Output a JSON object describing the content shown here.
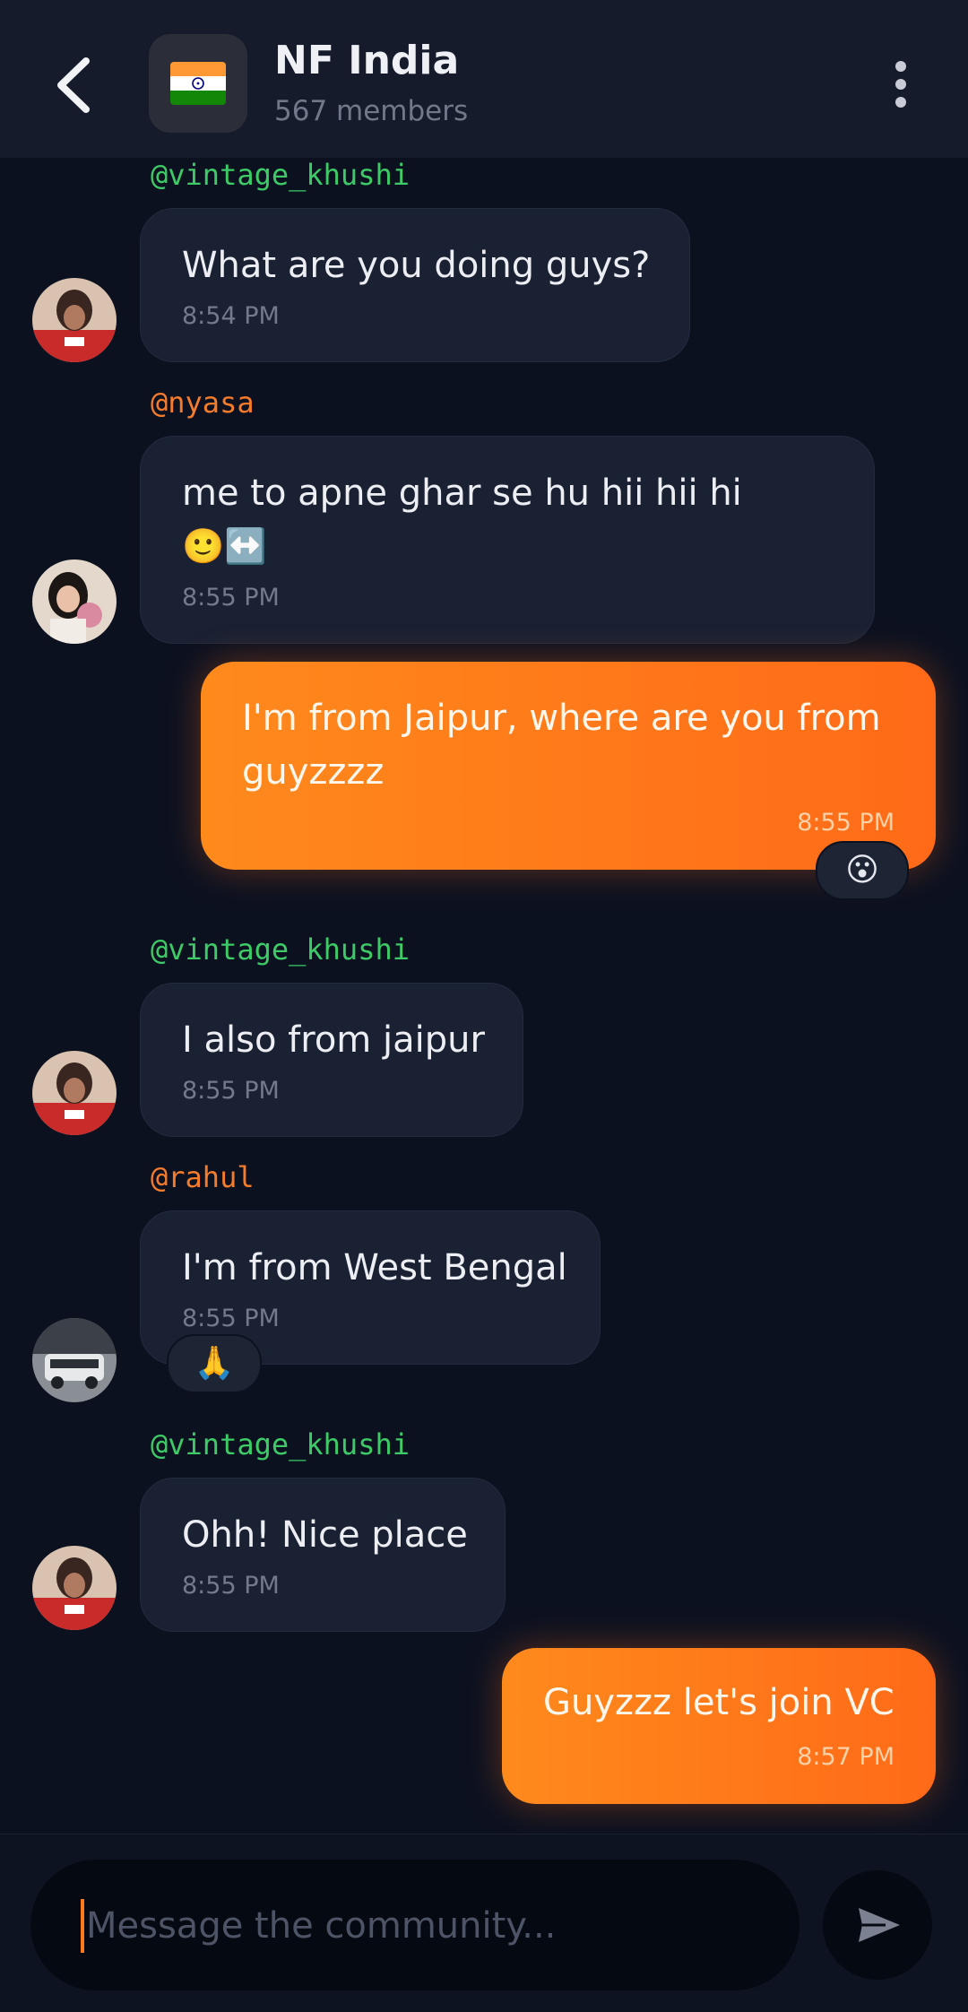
{
  "header": {
    "title": "NF India",
    "subtitle": "567 members",
    "back_icon": "chevron-left-icon",
    "menu_icon": "more-vertical-icon",
    "avatar_icon": "india-flag-icon"
  },
  "messages": [
    {
      "user": "@vintage_khushi",
      "text": "What are you doing guys?",
      "time": "8:54 PM"
    },
    {
      "user": "@nyasa",
      "text": "me to apne ghar se hu hii hii hi",
      "emoji": "🙂↔️",
      "time": "8:55 PM"
    },
    {
      "own": true,
      "line1": "I'm from Jaipur, where are you from",
      "line2": "guyzzzz",
      "time": "8:55 PM",
      "reaction": "😮"
    },
    {
      "user": "@vintage_khushi",
      "text": "I also from jaipur",
      "time": "8:55 PM"
    },
    {
      "user": "@rahul",
      "text": "I'm from West Bengal",
      "time": "8:55 PM",
      "reaction": "🙏"
    },
    {
      "user": "@vintage_khushi",
      "text": "Ohh! Nice place",
      "time": "8:55 PM"
    },
    {
      "own": true,
      "text": "Guyzzz let's join VC",
      "time": "8:57 PM"
    }
  ],
  "composer": {
    "placeholder": "Message the community...",
    "send_icon": "send-icon"
  },
  "colors": {
    "background": "#0c1120",
    "header": "#151b2b",
    "bubble": "#1a2133",
    "own_bubble": "#ff7a1c",
    "username_green": "#3dcb67",
    "username_orange": "#f47c2a"
  }
}
